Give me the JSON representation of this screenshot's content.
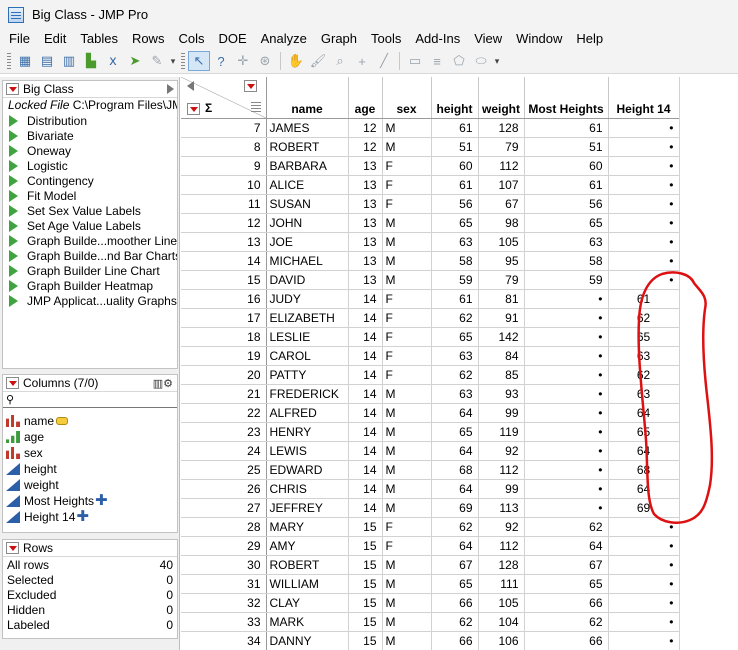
{
  "window": {
    "title": "Big Class - JMP Pro"
  },
  "menu": [
    "File",
    "Edit",
    "Tables",
    "Rows",
    "Cols",
    "DOE",
    "Analyze",
    "Graph",
    "Tools",
    "Add-Ins",
    "View",
    "Window",
    "Help"
  ],
  "toolbar": {
    "buttons": [
      "data-table-icon",
      "open-icon",
      "grid-icon",
      "distribution-icon",
      "fit-icon",
      "script-icon",
      "pencil-icon",
      "arrow-icon",
      "help-icon",
      "crosshair-icon",
      "lasso-icon",
      "hand-icon",
      "brush-icon",
      "zoom-icon",
      "plus-icon",
      "line-icon",
      "annotate-icon",
      "polygon-icon",
      "ellipse-icon"
    ]
  },
  "table_panel": {
    "title": "Big Class",
    "locked_label": "Locked File",
    "locked_path": "C:\\Program Files\\JM",
    "scripts": [
      "Distribution",
      "Bivariate",
      "Oneway",
      "Logistic",
      "Contingency",
      "Fit Model",
      "Set Sex Value Labels",
      "Set Age Value Labels",
      "Graph Builde...moother Line",
      "Graph Builde...nd Bar Charts",
      "Graph Builder Line Chart",
      "Graph Builder Heatmap",
      "JMP Applicat...uality Graphs"
    ]
  },
  "columns_panel": {
    "title": "Columns (7/0)",
    "search_icon": "search-icon",
    "columns": [
      {
        "name": "name",
        "type": "nominal",
        "extra": "tag"
      },
      {
        "name": "age",
        "type": "ordinal",
        "extra": ""
      },
      {
        "name": "sex",
        "type": "nominal",
        "extra": ""
      },
      {
        "name": "height",
        "type": "continuous",
        "extra": ""
      },
      {
        "name": "weight",
        "type": "continuous",
        "extra": ""
      },
      {
        "name": "Most Heights",
        "type": "continuous",
        "extra": "formula"
      },
      {
        "name": "Height 14",
        "type": "continuous",
        "extra": "formula"
      }
    ]
  },
  "rows_panel": {
    "title": "Rows",
    "stats": [
      {
        "label": "All rows",
        "value": "40"
      },
      {
        "label": "Selected",
        "value": "0"
      },
      {
        "label": "Excluded",
        "value": "0"
      },
      {
        "label": "Hidden",
        "value": "0"
      },
      {
        "label": "Labeled",
        "value": "0"
      }
    ]
  },
  "grid": {
    "corner_sigma": "Σ",
    "headers": [
      "name",
      "age",
      "sex",
      "height",
      "weight",
      "Most Heights",
      "Height 14"
    ],
    "rows": [
      {
        "n": "7",
        "name": "JAMES",
        "age": "12",
        "sex": "M",
        "height": "61",
        "weight": "128",
        "most": "61",
        "h14": "•"
      },
      {
        "n": "8",
        "name": "ROBERT",
        "age": "12",
        "sex": "M",
        "height": "51",
        "weight": "79",
        "most": "51",
        "h14": "•"
      },
      {
        "n": "9",
        "name": "BARBARA",
        "age": "13",
        "sex": "F",
        "height": "60",
        "weight": "112",
        "most": "60",
        "h14": "•"
      },
      {
        "n": "10",
        "name": "ALICE",
        "age": "13",
        "sex": "F",
        "height": "61",
        "weight": "107",
        "most": "61",
        "h14": "•"
      },
      {
        "n": "11",
        "name": "SUSAN",
        "age": "13",
        "sex": "F",
        "height": "56",
        "weight": "67",
        "most": "56",
        "h14": "•"
      },
      {
        "n": "12",
        "name": "JOHN",
        "age": "13",
        "sex": "M",
        "height": "65",
        "weight": "98",
        "most": "65",
        "h14": "•"
      },
      {
        "n": "13",
        "name": "JOE",
        "age": "13",
        "sex": "M",
        "height": "63",
        "weight": "105",
        "most": "63",
        "h14": "•"
      },
      {
        "n": "14",
        "name": "MICHAEL",
        "age": "13",
        "sex": "M",
        "height": "58",
        "weight": "95",
        "most": "58",
        "h14": "•"
      },
      {
        "n": "15",
        "name": "DAVID",
        "age": "13",
        "sex": "M",
        "height": "59",
        "weight": "79",
        "most": "59",
        "h14": "•"
      },
      {
        "n": "16",
        "name": "JUDY",
        "age": "14",
        "sex": "F",
        "height": "61",
        "weight": "81",
        "most": "•",
        "h14": "61"
      },
      {
        "n": "17",
        "name": "ELIZABETH",
        "age": "14",
        "sex": "F",
        "height": "62",
        "weight": "91",
        "most": "•",
        "h14": "62"
      },
      {
        "n": "18",
        "name": "LESLIE",
        "age": "14",
        "sex": "F",
        "height": "65",
        "weight": "142",
        "most": "•",
        "h14": "65"
      },
      {
        "n": "19",
        "name": "CAROL",
        "age": "14",
        "sex": "F",
        "height": "63",
        "weight": "84",
        "most": "•",
        "h14": "63"
      },
      {
        "n": "20",
        "name": "PATTY",
        "age": "14",
        "sex": "F",
        "height": "62",
        "weight": "85",
        "most": "•",
        "h14": "62"
      },
      {
        "n": "21",
        "name": "FREDERICK",
        "age": "14",
        "sex": "M",
        "height": "63",
        "weight": "93",
        "most": "•",
        "h14": "63"
      },
      {
        "n": "22",
        "name": "ALFRED",
        "age": "14",
        "sex": "M",
        "height": "64",
        "weight": "99",
        "most": "•",
        "h14": "64"
      },
      {
        "n": "23",
        "name": "HENRY",
        "age": "14",
        "sex": "M",
        "height": "65",
        "weight": "119",
        "most": "•",
        "h14": "65"
      },
      {
        "n": "24",
        "name": "LEWIS",
        "age": "14",
        "sex": "M",
        "height": "64",
        "weight": "92",
        "most": "•",
        "h14": "64"
      },
      {
        "n": "25",
        "name": "EDWARD",
        "age": "14",
        "sex": "M",
        "height": "68",
        "weight": "112",
        "most": "•",
        "h14": "68"
      },
      {
        "n": "26",
        "name": "CHRIS",
        "age": "14",
        "sex": "M",
        "height": "64",
        "weight": "99",
        "most": "•",
        "h14": "64"
      },
      {
        "n": "27",
        "name": "JEFFREY",
        "age": "14",
        "sex": "M",
        "height": "69",
        "weight": "113",
        "most": "•",
        "h14": "69"
      },
      {
        "n": "28",
        "name": "MARY",
        "age": "15",
        "sex": "F",
        "height": "62",
        "weight": "92",
        "most": "62",
        "h14": "•"
      },
      {
        "n": "29",
        "name": "AMY",
        "age": "15",
        "sex": "F",
        "height": "64",
        "weight": "112",
        "most": "64",
        "h14": "•"
      },
      {
        "n": "30",
        "name": "ROBERT",
        "age": "15",
        "sex": "M",
        "height": "67",
        "weight": "128",
        "most": "67",
        "h14": "•"
      },
      {
        "n": "31",
        "name": "WILLIAM",
        "age": "15",
        "sex": "M",
        "height": "65",
        "weight": "111",
        "most": "65",
        "h14": "•"
      },
      {
        "n": "32",
        "name": "CLAY",
        "age": "15",
        "sex": "M",
        "height": "66",
        "weight": "105",
        "most": "66",
        "h14": "•"
      },
      {
        "n": "33",
        "name": "MARK",
        "age": "15",
        "sex": "M",
        "height": "62",
        "weight": "104",
        "most": "62",
        "h14": "•"
      },
      {
        "n": "34",
        "name": "DANNY",
        "age": "15",
        "sex": "M",
        "height": "66",
        "weight": "106",
        "most": "66",
        "h14": "•"
      }
    ]
  },
  "annotation": {
    "color": "#dd1111"
  }
}
